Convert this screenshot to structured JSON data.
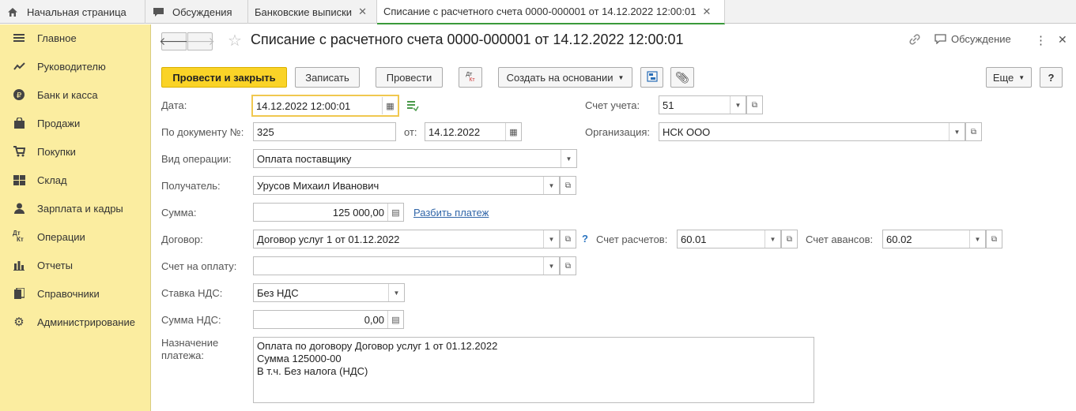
{
  "tabs": [
    {
      "label": "Начальная страница"
    },
    {
      "label": "Обсуждения"
    },
    {
      "label": "Банковские выписки"
    },
    {
      "label": "Списание с расчетного счета 0000-000001 от 14.12.2022 12:00:01"
    }
  ],
  "sidebar": {
    "items": [
      {
        "label": "Главное",
        "icon": "menu-icon"
      },
      {
        "label": "Руководителю",
        "icon": "trend-icon"
      },
      {
        "label": "Банк и касса",
        "icon": "ruble-icon"
      },
      {
        "label": "Продажи",
        "icon": "bag-icon"
      },
      {
        "label": "Покупки",
        "icon": "cart-icon"
      },
      {
        "label": "Склад",
        "icon": "warehouse-icon"
      },
      {
        "label": "Зарплата и кадры",
        "icon": "person-icon"
      },
      {
        "label": "Операции",
        "icon": "dt-kt-icon"
      },
      {
        "label": "Отчеты",
        "icon": "bar-chart-icon"
      },
      {
        "label": "Справочники",
        "icon": "books-icon"
      },
      {
        "label": "Администрирование",
        "icon": "gear-icon"
      }
    ]
  },
  "header": {
    "title": "Списание с расчетного счета 0000-000001 от 14.12.2022 12:00:01",
    "discussion": "Обсуждение"
  },
  "toolbar": {
    "post_close": "Провести и закрыть",
    "save": "Записать",
    "post": "Провести",
    "dtkt": "Дт Кт",
    "create_based": "Создать на основании",
    "more": "Еще",
    "help": "?"
  },
  "form": {
    "date_label": "Дата:",
    "date_value": "14.12.2022 12:00:01",
    "docnum_label": "По документу №:",
    "docnum_value": "325",
    "from_label": "от:",
    "from_value": "14.12.2022",
    "optype_label": "Вид операции:",
    "optype_value": "Оплата поставщику",
    "recipient_label": "Получатель:",
    "recipient_value": "Урусов Михаил Иванович",
    "sum_label": "Сумма:",
    "sum_value": "125 000,00",
    "split_link": "Разбить платеж",
    "contract_label": "Договор:",
    "contract_value": "Договор услуг 1 от 01.12.2022",
    "invoice_label": "Счет на оплату:",
    "invoice_value": "",
    "vat_rate_label": "Ставка НДС:",
    "vat_rate_value": "Без НДС",
    "vat_sum_label": "Сумма НДС:",
    "vat_sum_value": "0,00",
    "purpose_label_1": "Назначение",
    "purpose_label_2": "платежа:",
    "purpose_lines": [
      "Оплата по договору Договор услуг 1 от 01.12.2022",
      "Сумма 125000-00",
      "В т.ч. Без налога (НДС)"
    ],
    "account_label": "Счет учета:",
    "account_value": "51",
    "org_label": "Организация:",
    "org_value": "НСК ООО",
    "settle_label": "Счет расчетов:",
    "settle_value": "60.01",
    "advance_label": "Счет авансов:",
    "advance_value": "60.02"
  }
}
